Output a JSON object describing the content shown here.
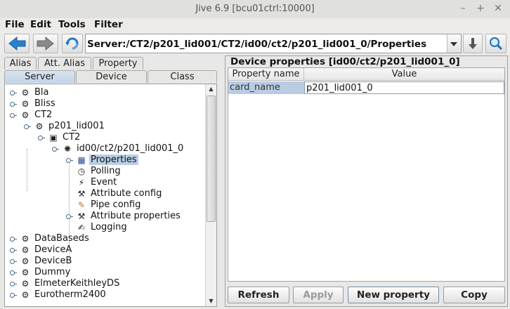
{
  "window": {
    "title": "Jive 6.9  [bcu01ctrl:10000]"
  },
  "menu": {
    "items": [
      "File",
      "Edit",
      "Tools",
      "Filter"
    ]
  },
  "toolbar": {
    "address": "Server:/CT2/p201_lid001/CT2/id00/ct2/p201_lid001_0/Properties"
  },
  "tabs": {
    "top": [
      "Alias",
      "Att. Alias",
      "Property"
    ],
    "bottom": [
      "Server",
      "Device",
      "Class"
    ],
    "selected": "Server"
  },
  "tree": {
    "nodes": [
      {
        "label": "Bla",
        "icon": "server-icon"
      },
      {
        "label": "Bliss",
        "icon": "server-icon"
      },
      {
        "label": "CT2",
        "icon": "server-icon"
      },
      {
        "label": "p201_lid001",
        "icon": "server-icon"
      },
      {
        "label": "CT2",
        "icon": "class-icon"
      },
      {
        "label": "id00/ct2/p201_lid001_0",
        "icon": "device-icon"
      },
      {
        "label": "Properties",
        "icon": "properties-icon",
        "selected": true
      },
      {
        "label": "Polling",
        "icon": "polling-icon"
      },
      {
        "label": "Event",
        "icon": "event-icon"
      },
      {
        "label": "Attribute config",
        "icon": "attribute-config-icon"
      },
      {
        "label": "Pipe config",
        "icon": "pipe-config-icon"
      },
      {
        "label": "Attribute properties",
        "icon": "attribute-properties-icon"
      },
      {
        "label": "Logging",
        "icon": "logging-icon"
      },
      {
        "label": "DataBaseds",
        "icon": "server-icon"
      },
      {
        "label": "DeviceA",
        "icon": "server-icon"
      },
      {
        "label": "DeviceB",
        "icon": "server-icon"
      },
      {
        "label": "Dummy",
        "icon": "server-icon"
      },
      {
        "label": "ElmeterKeithleyDS",
        "icon": "server-icon"
      },
      {
        "label": "Eurotherm2400",
        "icon": "server-icon"
      }
    ]
  },
  "properties_panel": {
    "title": "Device properties [id00/ct2/p201_lid001_0]",
    "columns": [
      "Property name",
      "Value"
    ],
    "rows": [
      {
        "name": "card_name",
        "value": "p201_lid001_0"
      }
    ],
    "buttons": {
      "refresh": "Refresh",
      "apply": "Apply",
      "new_property": "New property",
      "copy": "Copy"
    }
  }
}
